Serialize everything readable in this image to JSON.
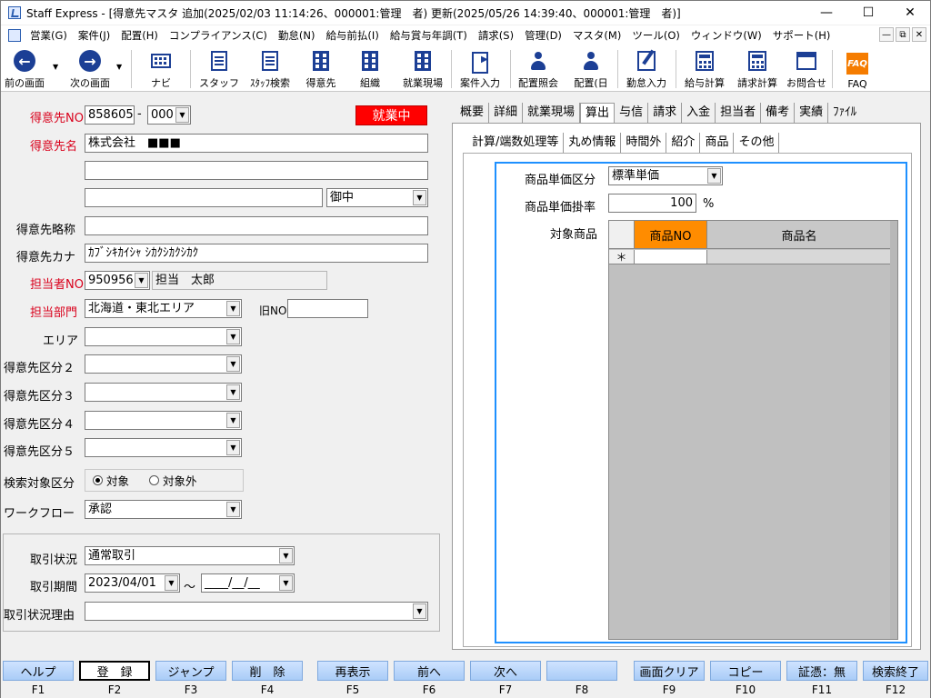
{
  "window": {
    "title": "Staff Express - [得意先マスタ 追加(2025/02/03 11:14:26、000001:管理　者) 更新(2025/05/26 14:39:40、000001:管理　者)]",
    "minimize": "—",
    "maximize": "☐",
    "close": "✕"
  },
  "menu": [
    "営業(G)",
    "案件(J)",
    "配置(H)",
    "コンプライアンス(C)",
    "勤怠(N)",
    "給与前払(I)",
    "給与賞与年調(T)",
    "請求(S)",
    "管理(D)",
    "マスタ(M)",
    "ツール(O)",
    "ウィンドウ(W)",
    "サポート(H)"
  ],
  "mdi": [
    "—",
    "⧉",
    "✕"
  ],
  "toolbar": {
    "prev": "前の画面",
    "next": "次の画面",
    "navi": "ナビ",
    "staff": "スタッフ",
    "staff_search": "ｽﾀｯﾌ検索",
    "customer": "得意先",
    "org": "組織",
    "site": "就業現場",
    "case_input": "案件入力",
    "assign_query": "配置照会",
    "assign_day": "配置(日",
    "attendance": "勤怠入力",
    "payroll": "給与計算",
    "billing": "請求計算",
    "inquiry": "お問合せ",
    "faq": "FAQ",
    "faq_icon": "FAQ"
  },
  "form": {
    "no_label": "得意先NO",
    "no_value": "858605",
    "no_dash": "-",
    "no_sub": "000",
    "status": "就業中",
    "name_label": "得意先名",
    "name_value": "株式会社　■■■",
    "name2": "",
    "name3": "",
    "honorific": "御中",
    "short_label": "得意先略称",
    "short_value": "",
    "kana_label": "得意先カナ",
    "kana_value": "ｶﾌﾞｼｷｶｲｼｬ ｼｶｸｼｶｸｼｶｸ",
    "rep_label": "担当者NO",
    "rep_no": "950956",
    "rep_name": "担当　太郎",
    "dept_label": "担当部門",
    "dept_value": "北海道・東北エリア",
    "oldno_label": "旧NO",
    "oldno_value": "",
    "area_label": "エリア",
    "cat2_label": "得意先区分２",
    "cat3_label": "得意先区分３",
    "cat4_label": "得意先区分４",
    "cat5_label": "得意先区分５",
    "search_label": "検索対象区分",
    "search_on": "対象",
    "search_off": "対象外",
    "workflow_label": "ワークフロー",
    "workflow_value": "承認",
    "trade_status_label": "取引状況",
    "trade_status_value": "通常取引",
    "trade_period_label": "取引期間",
    "trade_start": "2023/04/01",
    "tilde": "～",
    "trade_end": "____/__/__",
    "trade_reason_label": "取引状況理由",
    "trade_reason_value": ""
  },
  "tabs": [
    "概要",
    "詳細",
    "就業現場",
    "算出",
    "与信",
    "請求",
    "入金",
    "担当者",
    "備考",
    "実績",
    "ﾌｧｲﾙ"
  ],
  "subtabs": [
    "計算/端数処理等",
    "丸め情報",
    "時間外",
    "紹介",
    "商品",
    "その他"
  ],
  "product": {
    "price_type_label": "商品単価区分",
    "price_type_value": "標準単価",
    "rate_label": "商品単価掛率",
    "rate_value": "100",
    "rate_unit": "%",
    "target_label": "対象商品",
    "col_no": "商品NO",
    "col_name": "商品名",
    "new_row_marker": "＊"
  },
  "fkeys": [
    {
      "label": "ヘルプ",
      "key": "F1"
    },
    {
      "label": "登　録",
      "key": "F2"
    },
    {
      "label": "ジャンプ",
      "key": "F3"
    },
    {
      "label": "削　除",
      "key": "F4"
    },
    {
      "label": "再表示",
      "key": "F5"
    },
    {
      "label": "前へ",
      "key": "F6"
    },
    {
      "label": "次へ",
      "key": "F7"
    },
    {
      "label": "",
      "key": "F8"
    },
    {
      "label": "画面クリア",
      "key": "F9"
    },
    {
      "label": "コピー",
      "key": "F10"
    },
    {
      "label": "証憑：無",
      "key": "F11"
    },
    {
      "label": "検索終了",
      "key": "F12"
    }
  ],
  "colors": {
    "required_label": "#d9001b",
    "status_bg": "#ff0000",
    "grid_header": "#ff8c00",
    "focus_frame": "#1e90ff"
  }
}
